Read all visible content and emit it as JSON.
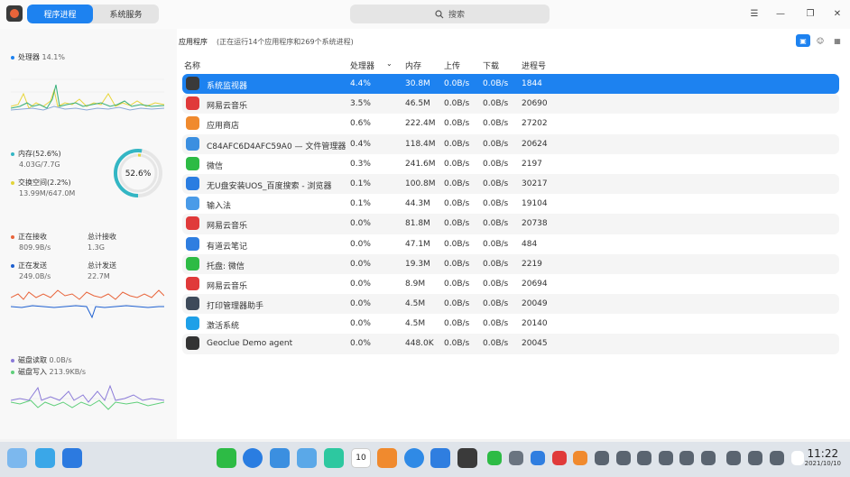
{
  "tabs": {
    "active": "程序进程",
    "other": "系统服务"
  },
  "search": {
    "label": "搜索"
  },
  "sidebar": {
    "cpu_label": "处理器",
    "cpu_value": "14.1%",
    "mem_label": "内存(52.6%)",
    "mem_value": "4.03G/7.7G",
    "swap_label": "交换空间(2.2%)",
    "swap_value": "13.99M/647.0M",
    "mem_ring": "52.6%",
    "recv_label": "正在接收",
    "recv_value": "809.9B/s",
    "recv_total_label": "总计接收",
    "recv_total_value": "1.3G",
    "send_label": "正在发送",
    "send_value": "249.0B/s",
    "send_total_label": "总计发送",
    "send_total_value": "22.7M",
    "disk_read_label": "磁盘读取",
    "disk_read_value": "0.0B/s",
    "disk_write_label": "磁盘写入",
    "disk_write_value": "213.9KB/s"
  },
  "main": {
    "section_title": "应用程序",
    "summary": "(正在运行14个应用程序和269个系统进程)",
    "columns": [
      "名称",
      "处理器",
      "内存",
      "上传",
      "下载",
      "进程号"
    ],
    "rows": [
      {
        "name": "系统监视器",
        "cpu": "4.4%",
        "mem": "30.8M",
        "up": "0.0B/s",
        "down": "0.0B/s",
        "pid": "1844",
        "icon": "monitor-icon",
        "color": "#3a3a3a"
      },
      {
        "name": "网易云音乐",
        "cpu": "3.5%",
        "mem": "46.5M",
        "up": "0.0B/s",
        "down": "0.0B/s",
        "pid": "20690",
        "icon": "netease-music-icon",
        "color": "#e03a3a"
      },
      {
        "name": "应用商店",
        "cpu": "0.6%",
        "mem": "222.4M",
        "up": "0.0B/s",
        "down": "0.0B/s",
        "pid": "27202",
        "icon": "app-store-icon",
        "color": "#f08a2e"
      },
      {
        "name": "C84AFC6D4AFC59A0 — 文件管理器",
        "cpu": "0.4%",
        "mem": "118.4M",
        "up": "0.0B/s",
        "down": "0.0B/s",
        "pid": "20624",
        "icon": "file-manager-icon",
        "color": "#3b8fe0"
      },
      {
        "name": "微信",
        "cpu": "0.3%",
        "mem": "241.6M",
        "up": "0.0B/s",
        "down": "0.0B/s",
        "pid": "2197",
        "icon": "wechat-icon",
        "color": "#2dbb45"
      },
      {
        "name": "无U盘安装UOS_百度搜索 - 浏览器",
        "cpu": "0.1%",
        "mem": "100.8M",
        "up": "0.0B/s",
        "down": "0.0B/s",
        "pid": "30217",
        "icon": "browser-icon",
        "color": "#2a7de1"
      },
      {
        "name": "输入法",
        "cpu": "0.1%",
        "mem": "44.3M",
        "up": "0.0B/s",
        "down": "0.0B/s",
        "pid": "19104",
        "icon": "input-method-icon",
        "color": "#4a9be8"
      },
      {
        "name": "网易云音乐",
        "cpu": "0.0%",
        "mem": "81.8M",
        "up": "0.0B/s",
        "down": "0.0B/s",
        "pid": "20738",
        "icon": "netease-music-icon",
        "color": "#e03a3a"
      },
      {
        "name": "有道云笔记",
        "cpu": "0.0%",
        "mem": "47.1M",
        "up": "0.0B/s",
        "down": "0.0B/s",
        "pid": "484",
        "icon": "youdao-note-icon",
        "color": "#2f7ee0"
      },
      {
        "name": "托盘: 微信",
        "cpu": "0.0%",
        "mem": "19.3M",
        "up": "0.0B/s",
        "down": "0.0B/s",
        "pid": "2219",
        "icon": "wechat-icon",
        "color": "#2dbb45"
      },
      {
        "name": "网易云音乐",
        "cpu": "0.0%",
        "mem": "8.9M",
        "up": "0.0B/s",
        "down": "0.0B/s",
        "pid": "20694",
        "icon": "netease-music-icon",
        "color": "#e03a3a"
      },
      {
        "name": "打印管理器助手",
        "cpu": "0.0%",
        "mem": "4.5M",
        "up": "0.0B/s",
        "down": "0.0B/s",
        "pid": "20049",
        "icon": "printer-icon",
        "color": "#3e4a5a"
      },
      {
        "name": "激活系统",
        "cpu": "0.0%",
        "mem": "4.5M",
        "up": "0.0B/s",
        "down": "0.0B/s",
        "pid": "20140",
        "icon": "activation-icon",
        "color": "#1ea0e8"
      },
      {
        "name": "Geoclue Demo agent",
        "cpu": "0.0%",
        "mem": "448.0K",
        "up": "0.0B/s",
        "down": "0.0B/s",
        "pid": "20045",
        "icon": "location-pin-icon",
        "color": "#333333"
      }
    ]
  },
  "clock": {
    "time": "11:22",
    "date": "2021/10/10"
  },
  "calendar_day": "10",
  "colors": {
    "accent": "#1d82f0"
  }
}
